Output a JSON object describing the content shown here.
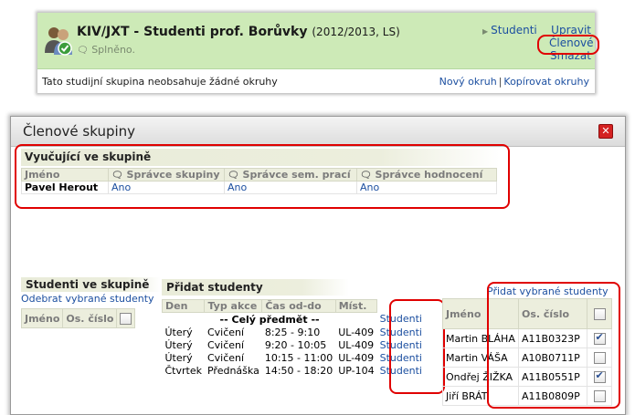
{
  "group": {
    "title": "KIV/JXT - Studenti prof. Borůvky",
    "title_suffix": "(2012/2013, LS)",
    "status": "Splněno.",
    "link_students": "Studenti",
    "link_edit": "Upravit",
    "link_members": "Členové",
    "link_delete": "Smazat",
    "empty_text": "Tato studijní skupina neobsahuje žádné okruhy",
    "new_topic": "Nový okruh",
    "copy_topics": "Kopírovat okruhy",
    "separator": "|"
  },
  "dialog": {
    "title": "Členové skupiny",
    "close_icon": "close-icon"
  },
  "teachers": {
    "heading": "Vyučující ve skupině",
    "columns": [
      "Jméno",
      "Správce skupiny",
      "Správce sem. prací",
      "Správce hodnocení"
    ],
    "rows": [
      {
        "name": "Pavel Herout",
        "group_admin": "Ano",
        "seminar_admin": "Ano",
        "grading_admin": "Ano"
      }
    ]
  },
  "students_in_group": {
    "heading": "Studenti ve skupině",
    "remove_selected": "Odebrat vybrané studenty",
    "columns": [
      "Jméno",
      "Os. číslo"
    ]
  },
  "add_students": {
    "heading": "Přidat studenty",
    "columns": [
      "Den",
      "Typ akce",
      "Čas od-do",
      "Míst."
    ],
    "whole_course": "-- Celý předmět --",
    "students_link": "Studenti",
    "lessons": [
      {
        "day": "Úterý",
        "type": "Cvičení",
        "time": "8:25 - 9:10",
        "room": "UL-409"
      },
      {
        "day": "Úterý",
        "type": "Cvičení",
        "time": "9:20 - 10:05",
        "room": "UL-409"
      },
      {
        "day": "Úterý",
        "type": "Cvičení",
        "time": "10:15 - 11:00",
        "room": "UL-409"
      },
      {
        "day": "Čtvrtek",
        "type": "Přednáška",
        "time": "14:50 - 18:20",
        "room": "UP-104"
      }
    ],
    "add_selected": "Přidat vybrané studenty",
    "candidate_columns": [
      "Jméno",
      "Os. číslo"
    ],
    "candidates": [
      {
        "name": "Martin BLÁHA",
        "id": "A11B0323P",
        "checked": true
      },
      {
        "name": "Martin VÁŠA",
        "id": "A10B0711P",
        "checked": false
      },
      {
        "name": "Ondřej ŽIŽKA",
        "id": "A11B0551P",
        "checked": true
      },
      {
        "name": "Jiří BRÁT",
        "id": "A11B0809P",
        "checked": false
      }
    ]
  },
  "colors": {
    "header_green": "#cdeab7",
    "link_blue": "#1c4fa0",
    "highlight_red": "#e00000"
  }
}
